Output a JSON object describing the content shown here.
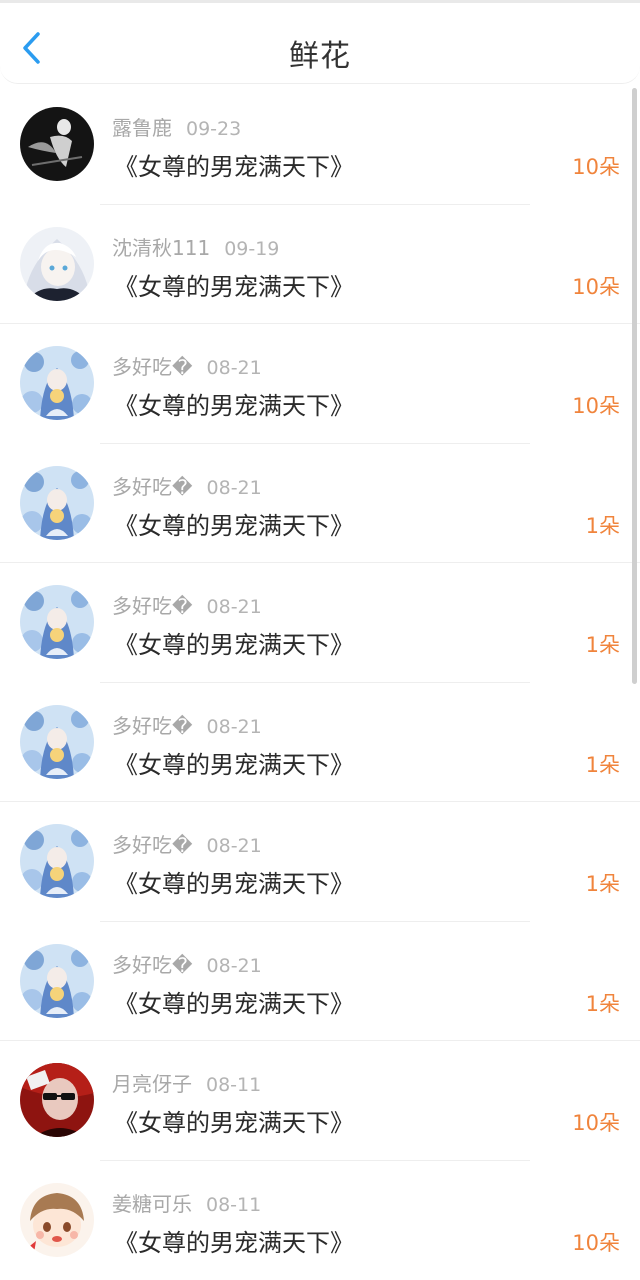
{
  "header": {
    "title": "鲜花",
    "back_icon": "chevron-left-icon",
    "accent": "#2b9cf0"
  },
  "colors": {
    "count": "#f0843c"
  },
  "gifts": [
    {
      "user": "露鲁鹿",
      "date": "09-23",
      "book": "《女尊的男宠满天下》",
      "count": "10朵",
      "avatar": "dark-figure"
    },
    {
      "user": "沈清秋111",
      "date": "09-19",
      "book": "《女尊的男宠满天下》",
      "count": "10朵",
      "avatar": "white-hair"
    },
    {
      "user": "多好吃�",
      "date": "08-21",
      "book": "《女尊的男宠满天下》",
      "count": "10朵",
      "avatar": "blue-art"
    },
    {
      "user": "多好吃�",
      "date": "08-21",
      "book": "《女尊的男宠满天下》",
      "count": "1朵",
      "avatar": "blue-art"
    },
    {
      "user": "多好吃�",
      "date": "08-21",
      "book": "《女尊的男宠满天下》",
      "count": "1朵",
      "avatar": "blue-art"
    },
    {
      "user": "多好吃�",
      "date": "08-21",
      "book": "《女尊的男宠满天下》",
      "count": "1朵",
      "avatar": "blue-art"
    },
    {
      "user": "多好吃�",
      "date": "08-21",
      "book": "《女尊的男宠满天下》",
      "count": "1朵",
      "avatar": "blue-art"
    },
    {
      "user": "多好吃�",
      "date": "08-21",
      "book": "《女尊的男宠满天下》",
      "count": "1朵",
      "avatar": "blue-art"
    },
    {
      "user": "月亮伢子",
      "date": "08-11",
      "book": "《女尊的男宠满天下》",
      "count": "10朵",
      "avatar": "red-sunglasses"
    },
    {
      "user": "姜糖可乐",
      "date": "08-11",
      "book": "《女尊的男宠满天下》",
      "count": "10朵",
      "avatar": "cartoon-boy"
    }
  ]
}
